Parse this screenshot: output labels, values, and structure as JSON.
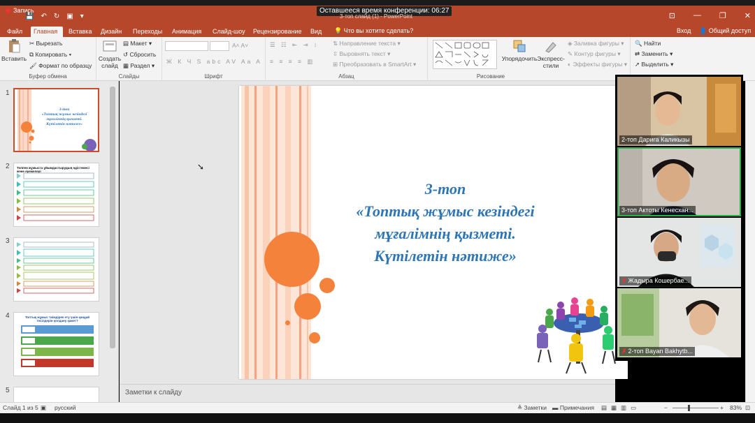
{
  "titlebar": {
    "record_label": "Запись",
    "conference_timer": "Оставшееся время конференции: 06:27",
    "doc_title": "3-топ слайд (1) - PowerPoint",
    "quick_access": [
      "💾",
      "↶",
      "↻",
      "▣",
      "▾"
    ],
    "window_controls": [
      "⊡",
      "—",
      "❐",
      "✕"
    ]
  },
  "tabs": [
    "Файл",
    "Главная",
    "Вставка",
    "Дизайн",
    "Переходы",
    "Анимация",
    "Слайд-шоу",
    "Рецензирование",
    "Вид"
  ],
  "tell_me": "Что вы хотите сделать?",
  "sign_in": "Вход",
  "share": "Общий доступ",
  "ribbon": {
    "clipboard": {
      "paste": "Вставить",
      "cut": "Вырезать",
      "copy": "Копировать",
      "format_painter": "Формат по образцу",
      "label": "Буфер обмена"
    },
    "slides": {
      "new_slide": "Создать слайд",
      "layout": "Макет",
      "reset": "Сбросить",
      "section": "Раздел",
      "label": "Слайды"
    },
    "font": {
      "label": "Шрифт",
      "buttons": [
        "Ж",
        "К",
        "Ч",
        "S",
        "abc",
        "AV",
        "Aa",
        "A"
      ]
    },
    "paragraph": {
      "text_direction": "Направление текста",
      "align_text": "Выровнять текст",
      "smartart": "Преобразовать в SmartArt",
      "label": "Абзац"
    },
    "drawing": {
      "arrange": "Упорядочить",
      "quick_styles": "Экспресс-стили",
      "shape_fill": "Заливка фигуры",
      "shape_outline": "Контур фигуры",
      "shape_effects": "Эффекты фигуры",
      "label": "Рисование"
    },
    "editing": {
      "find": "Найти",
      "replace": "Заменить",
      "select": "Выделить"
    }
  },
  "slides": [
    {
      "number": "1",
      "title_lines": [
        "3-топ",
        "«Топтық жұмыс кезіндегі",
        "мұғалімнің қызметі.",
        "Күтілетін нәтиже»"
      ]
    },
    {
      "number": "2",
      "title": "Топпен жұмыста ұйымдастырудың әдістемесі және ережелері"
    },
    {
      "number": "3"
    },
    {
      "number": "4",
      "title": "Топтық жұмыс тиімдірек ету үшін қандай тәсілдерін қолдану қажет?"
    },
    {
      "number": "5"
    }
  ],
  "main_slide": {
    "title_lines": [
      "3-топ",
      "«Топтық жұмыс кезіндегі",
      "мұғалімнің қызметі.",
      "Күтілетін нәтиже»"
    ],
    "title_color": "#2e75b6",
    "accent_color": "#f5823a"
  },
  "notes_placeholder": "Заметки к слайду",
  "participants": [
    {
      "name": "2-топ Дарига Каликызы",
      "muted": false
    },
    {
      "name": "3-топ Актоты Кенесхан...",
      "muted": false
    },
    {
      "name": "Жадыра Кошербае...",
      "muted": true
    },
    {
      "name": "2-топ Bayan Bakhytb...",
      "muted": true
    }
  ],
  "statusbar": {
    "slide_counter": "Слайд 1 из 5",
    "language": "русский",
    "notes": "Заметки",
    "comments": "Примечания",
    "zoom": "83%"
  }
}
